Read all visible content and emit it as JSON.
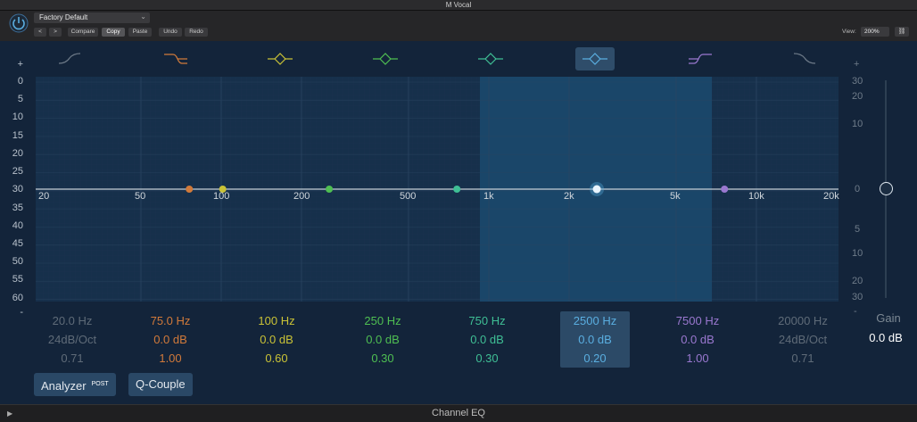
{
  "window": {
    "title": "M Vocal"
  },
  "header": {
    "preset": "Factory Default",
    "buttons": {
      "back": "<",
      "forward": ">",
      "compare": "Compare",
      "copy": "Copy",
      "paste": "Paste",
      "undo": "Undo",
      "redo": "Redo"
    },
    "view_label": "View:",
    "view_value": "200%"
  },
  "graph": {
    "db_left": [
      "+",
      "0",
      "5",
      "10",
      "15",
      "20",
      "25",
      "30",
      "35",
      "40",
      "45",
      "50",
      "55",
      "60",
      "-"
    ],
    "db_right": [
      "+",
      "30",
      "20",
      "10",
      "0",
      "5",
      "10",
      "20",
      "30",
      "-"
    ],
    "freq_labels": [
      "20",
      "50",
      "100",
      "200",
      "500",
      "1k",
      "2k",
      "5k",
      "10k",
      "20k"
    ]
  },
  "bands": [
    {
      "freq": "20.0 Hz",
      "gain": "24dB/Oct",
      "q": "0.71",
      "color": "#5f6b78",
      "type": "low-cut"
    },
    {
      "freq": "75.0 Hz",
      "gain": "0.0 dB",
      "q": "1.00",
      "color": "#d27a3a",
      "type": "low-shelf"
    },
    {
      "freq": "100 Hz",
      "gain": "0.0 dB",
      "q": "0.60",
      "color": "#c9c236",
      "type": "bell"
    },
    {
      "freq": "250 Hz",
      "gain": "0.0 dB",
      "q": "0.30",
      "color": "#4fbf52",
      "type": "bell"
    },
    {
      "freq": "750 Hz",
      "gain": "0.0 dB",
      "q": "0.30",
      "color": "#3fbf95",
      "type": "bell"
    },
    {
      "freq": "2500 Hz",
      "gain": "0.0 dB",
      "q": "0.20",
      "color": "#5aaee0",
      "type": "bell",
      "selected": true
    },
    {
      "freq": "7500 Hz",
      "gain": "0.0 dB",
      "q": "1.00",
      "color": "#9a78d0",
      "type": "high-shelf"
    },
    {
      "freq": "20000 Hz",
      "gain": "24dB/Oct",
      "q": "0.71",
      "color": "#5f6b78",
      "type": "high-cut"
    }
  ],
  "gain": {
    "label": "Gain",
    "value": "0.0 dB"
  },
  "buttons": {
    "analyzer": "Analyzer",
    "analyzer_badge": "POST",
    "q_couple": "Q-Couple"
  },
  "footer": {
    "title": "Channel EQ"
  }
}
